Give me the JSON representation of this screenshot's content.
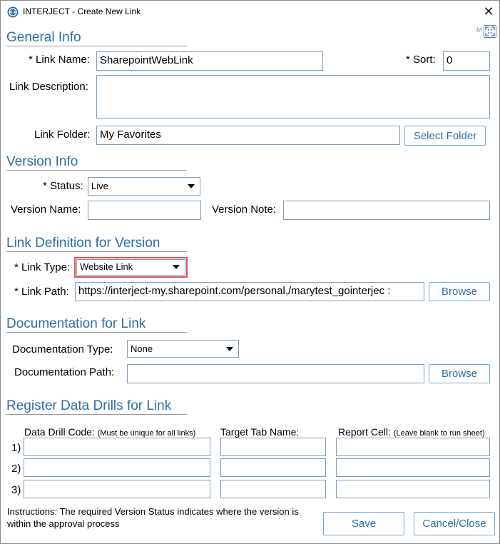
{
  "window": {
    "title": "INTERJECT - Create New Link",
    "close_glyph": "✕",
    "maximize_letter": "M"
  },
  "general_info": {
    "section_title": "General Info",
    "link_name_label": "* Link Name:",
    "link_name_value": "SharepointWebLink",
    "sort_label": "* Sort:",
    "sort_value": "0",
    "link_description_label": "Link Description:",
    "link_description_value": "",
    "link_folder_label": "Link Folder:",
    "link_folder_value": "My Favorites",
    "select_folder_label": "Select Folder"
  },
  "version_info": {
    "section_title": "Version Info",
    "status_label": "* Status:",
    "status_value": "Live",
    "version_name_label": "Version Name:",
    "version_name_value": "",
    "version_note_label": "Version Note:",
    "version_note_value": ""
  },
  "link_definition": {
    "section_title": "Link Definition for Version",
    "link_type_label": "* Link Type:",
    "link_type_value": "Website Link",
    "link_path_label": "* Link Path:",
    "link_path_value": "https://interject-my.sharepoint.com/personal,/marytest_gointerjec :",
    "browse_label": "Browse"
  },
  "documentation": {
    "section_title": "Documentation for Link",
    "doc_type_label": "Documentation Type:",
    "doc_type_value": "None",
    "doc_path_label": "Documentation Path:",
    "doc_path_value": "",
    "browse_label": "Browse"
  },
  "data_drills": {
    "section_title": "Register Data Drills for Link",
    "col_code_label": "Data Drill Code:",
    "col_code_note": "(Must be unique for all links)",
    "col_target_label": "Target Tab Name:",
    "col_report_label": "Report Cell:",
    "col_report_note": "(Leave blank to run sheet)",
    "rows": [
      {
        "num": "1)",
        "code": "",
        "target": "",
        "report": ""
      },
      {
        "num": "2)",
        "code": "",
        "target": "",
        "report": ""
      },
      {
        "num": "3)",
        "code": "",
        "target": "",
        "report": ""
      }
    ]
  },
  "footer": {
    "instructions": "Instructions: The required Version Status indicates where the version is within the approval process",
    "save_label": "Save",
    "cancel_label": "Cancel/Close"
  },
  "colors": {
    "accent": "#2e6da4",
    "input_border": "#7f9db9",
    "highlight": "#e05050"
  }
}
